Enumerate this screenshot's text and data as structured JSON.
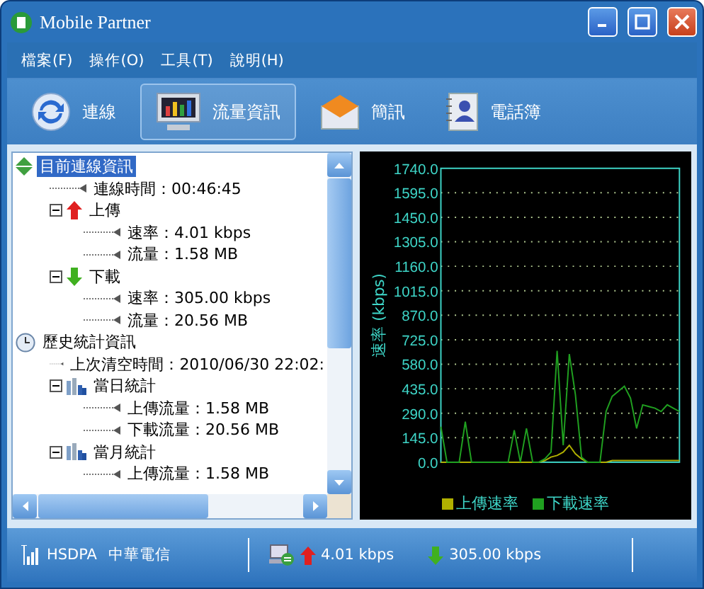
{
  "window": {
    "title": "Mobile Partner"
  },
  "menu": [
    {
      "label": "檔案(F)"
    },
    {
      "label": "操作(O)"
    },
    {
      "label": "工具(T)"
    },
    {
      "label": "說明(H)"
    }
  ],
  "toolbar": [
    {
      "label": "連線",
      "kind": "connect",
      "selected": false
    },
    {
      "label": "流量資訊",
      "kind": "traffic",
      "selected": true
    },
    {
      "label": "簡訊",
      "kind": "sms",
      "selected": false
    },
    {
      "label": "電話簿",
      "kind": "phonebook",
      "selected": false
    }
  ],
  "tree": [
    {
      "label": "目前連線資訊",
      "kind": "connection",
      "selected": true,
      "expanded": true,
      "children": [
        {
          "label": "連線時間：00:46:45",
          "selected": false
        },
        {
          "label": "上傳",
          "kind": "upload",
          "selected": false,
          "expanded": true,
          "children": [
            {
              "label": "速率：4.01 kbps",
              "selected": false
            },
            {
              "label": "流量：1.58 MB",
              "selected": false
            }
          ]
        },
        {
          "label": "下載",
          "kind": "download",
          "selected": false,
          "expanded": true,
          "children": [
            {
              "label": "速率：305.00 kbps",
              "selected": false
            },
            {
              "label": "流量：20.56 MB",
              "selected": false
            }
          ]
        }
      ]
    },
    {
      "label": "歷史統計資訊",
      "kind": "clock",
      "selected": false,
      "expanded": true,
      "children": [
        {
          "label": "上次清空時間：2010/06/30 22:02:",
          "selected": false
        },
        {
          "label": "當日統計",
          "kind": "stats",
          "selected": false,
          "expanded": true,
          "children": [
            {
              "label": "上傳流量：1.58 MB",
              "selected": false
            },
            {
              "label": "下載流量：20.56 MB",
              "selected": false
            }
          ]
        },
        {
          "label": "當月統計",
          "kind": "stats",
          "selected": false,
          "expanded": true,
          "children": [
            {
              "label": "上傳流量：1.58 MB",
              "selected": false
            }
          ]
        }
      ]
    }
  ],
  "chart": {
    "chart_data": {
      "type": "line",
      "ylabel": "速率 (kbps)",
      "ylim": [
        0,
        1740
      ],
      "grid": true,
      "yticks": [
        {
          "value": 0,
          "label": "0.0"
        },
        {
          "value": 145,
          "label": "145.0"
        },
        {
          "value": 290,
          "label": "290.0"
        },
        {
          "value": 435,
          "label": "435.0"
        },
        {
          "value": 580,
          "label": "580.0"
        },
        {
          "value": 725,
          "label": "725.0"
        },
        {
          "value": 870,
          "label": "870.0"
        },
        {
          "value": 1015,
          "label": "1015.0"
        },
        {
          "value": 1160,
          "label": "1160.0"
        },
        {
          "value": 1305,
          "label": "1305.0"
        },
        {
          "value": 1450,
          "label": "1450.0"
        },
        {
          "value": 1595,
          "label": "1595.0"
        },
        {
          "value": 1740,
          "label": "1740.0"
        }
      ],
      "series": [
        {
          "name": "上傳速率",
          "color": "#b0b000",
          "values": [
            0,
            0,
            0,
            0,
            0,
            0,
            0,
            0,
            0,
            0,
            0,
            0,
            0,
            0,
            0,
            0,
            0,
            10,
            30,
            40,
            60,
            100,
            50,
            20,
            0,
            0,
            0,
            0,
            10,
            10,
            10,
            10,
            10,
            10,
            10,
            10,
            10,
            10,
            10,
            10
          ]
        },
        {
          "name": "下載速率",
          "color": "#20a020",
          "values": [
            210,
            0,
            0,
            0,
            240,
            0,
            0,
            0,
            0,
            0,
            0,
            0,
            190,
            0,
            200,
            0,
            0,
            20,
            60,
            660,
            100,
            640,
            400,
            30,
            0,
            0,
            0,
            300,
            390,
            420,
            450,
            380,
            200,
            340,
            330,
            320,
            300,
            340,
            320,
            300
          ]
        }
      ]
    }
  },
  "status_bar": {
    "network": "HSDPA",
    "carrier": "中華電信",
    "upload": "4.01 kbps",
    "download": "305.00 kbps"
  }
}
